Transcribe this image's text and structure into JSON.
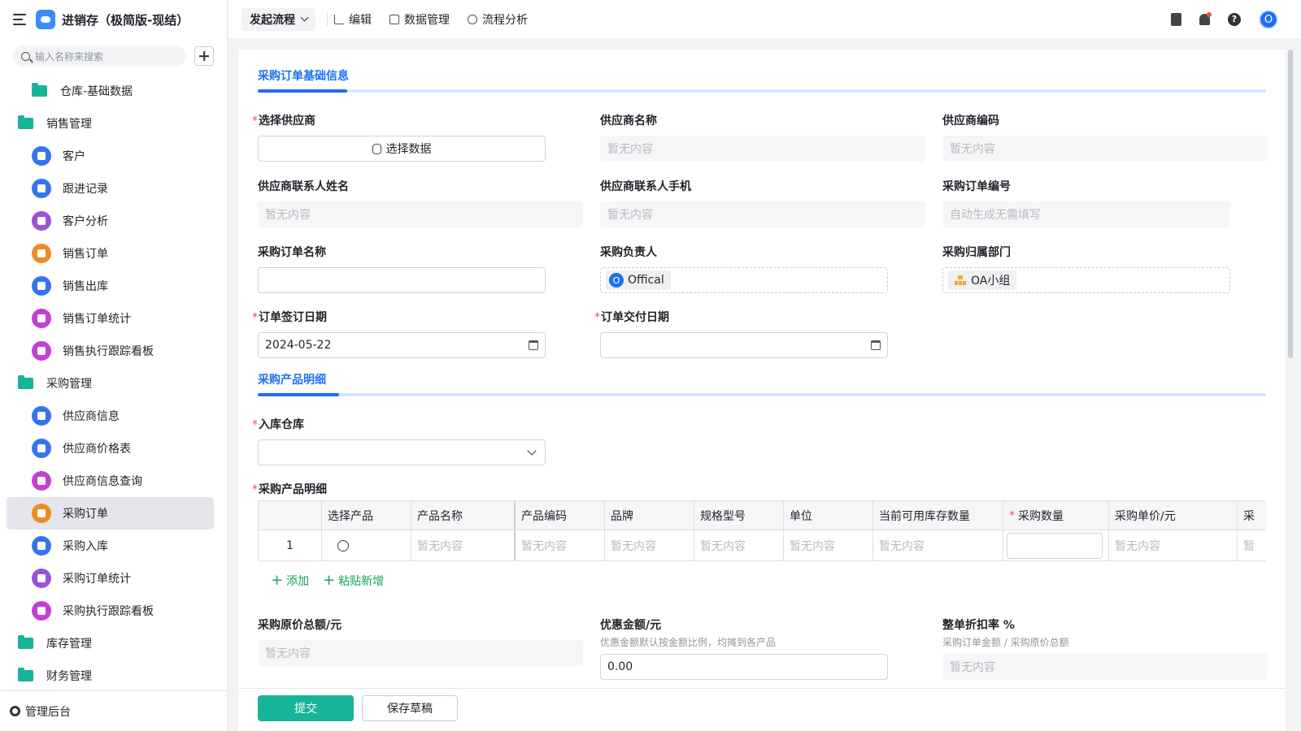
{
  "app": {
    "title": "进销存（极简版-现结）"
  },
  "sidebar": {
    "search_placeholder": "输入名称来搜索",
    "items": [
      {
        "label": "仓库-基础数据",
        "type": "sub",
        "icon": "folder-icon"
      },
      {
        "label": "销售管理",
        "type": "group",
        "icon": "folder-icon"
      },
      {
        "label": "客户",
        "type": "child",
        "icon": "user-icon"
      },
      {
        "label": "跟进记录",
        "type": "child",
        "icon": "document-icon"
      },
      {
        "label": "客户分析",
        "type": "child",
        "icon": "chart-icon"
      },
      {
        "label": "销售订单",
        "type": "child",
        "icon": "order-icon"
      },
      {
        "label": "销售出库",
        "type": "child",
        "icon": "document-icon"
      },
      {
        "label": "销售订单统计",
        "type": "child",
        "icon": "dashboard-icon"
      },
      {
        "label": "销售执行跟踪看板",
        "type": "child",
        "icon": "dashboard-icon"
      },
      {
        "label": "采购管理",
        "type": "group",
        "icon": "folder-icon"
      },
      {
        "label": "供应商信息",
        "type": "child",
        "icon": "user-icon"
      },
      {
        "label": "供应商价格表",
        "type": "child",
        "icon": "document-icon"
      },
      {
        "label": "供应商信息查询",
        "type": "child",
        "icon": "dashboard-icon"
      },
      {
        "label": "采购订单",
        "type": "child",
        "icon": "order-icon",
        "active": true
      },
      {
        "label": "采购入库",
        "type": "child",
        "icon": "document-icon"
      },
      {
        "label": "采购订单统计",
        "type": "child",
        "icon": "chart-icon"
      },
      {
        "label": "采购执行跟踪看板",
        "type": "child",
        "icon": "home-icon"
      },
      {
        "label": "库存管理",
        "type": "group",
        "icon": "folder-icon"
      },
      {
        "label": "财务管理",
        "type": "group",
        "icon": "folder-icon"
      }
    ],
    "footer_label": "管理后台"
  },
  "topbar": {
    "start_flow": "发起流程",
    "edit": "编辑",
    "data_manage": "数据管理",
    "flow_analysis": "流程分析",
    "avatar_letter": "O"
  },
  "form": {
    "section1_title": "采购订单基础信息",
    "section2_title": "采购产品明细",
    "supplier_select": {
      "label": "选择供应商",
      "button": "选择数据"
    },
    "supplier_name": {
      "label": "供应商名称",
      "value": "暂无内容"
    },
    "supplier_code": {
      "label": "供应商编码",
      "value": "暂无内容"
    },
    "contact_name": {
      "label": "供应商联系人姓名",
      "value": "暂无内容"
    },
    "contact_phone": {
      "label": "供应商联系人手机",
      "value": "暂无内容"
    },
    "order_no": {
      "label": "采购订单编号",
      "value": "自动生成无需填写"
    },
    "order_name": {
      "label": "采购订单名称",
      "value": ""
    },
    "purchaser": {
      "label": "采购负责人",
      "tag_letter": "O",
      "tag": "Offical"
    },
    "department": {
      "label": "采购归属部门",
      "tag": "OA小组"
    },
    "sign_date": {
      "label": "订单签订日期",
      "value": "2024-05-22"
    },
    "delivery_date": {
      "label": "订单交付日期",
      "value": ""
    },
    "warehouse": {
      "label": "入库仓库",
      "value": ""
    },
    "detail_label": "采购产品明细",
    "table": {
      "headers": [
        "",
        "选择产品",
        "产品名称",
        "产品编码",
        "品牌",
        "规格型号",
        "单位",
        "当前可用库存数量",
        "采购数量",
        "采购单价/元",
        "采"
      ],
      "row": [
        "1",
        "",
        "暂无内容",
        "暂无内容",
        "暂无内容",
        "暂无内容",
        "暂无内容",
        "暂无内容",
        "",
        "暂无内容",
        "暂"
      ]
    },
    "add_link": "添加",
    "paste_link": "粘贴新增",
    "total_original": {
      "label": "采购原价总额/元",
      "value": "暂无内容"
    },
    "discount_amount": {
      "label": "优惠金额/元",
      "hint": "优惠金额默认按金额比例，均摊到各产品",
      "value": "0.00"
    },
    "discount_rate": {
      "label": "整单折扣率 %",
      "hint": "采购订单金额 / 采购原价总额",
      "value": "暂无内容"
    }
  },
  "footer": {
    "submit": "提交",
    "save_draft": "保存草稿"
  },
  "colors": {
    "accent": "#1f6ff5",
    "primary_button": "#16b59a",
    "required": "#f54a45",
    "folder": "#16b59a"
  }
}
